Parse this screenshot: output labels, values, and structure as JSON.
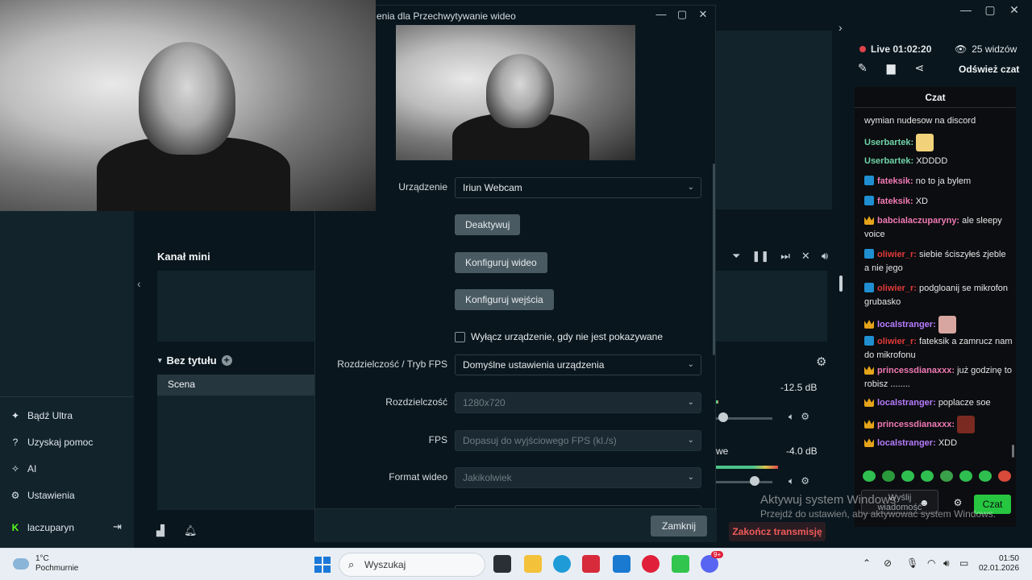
{
  "app": {
    "window_controls": [
      "—",
      "▢",
      "✕"
    ],
    "left_sidebar": {
      "items": [
        {
          "icon": "sparkle-icon",
          "label": "Bądź Ultra"
        },
        {
          "icon": "help-icon",
          "label": "Uzyskaj pomoc"
        },
        {
          "icon": "ai-icon",
          "label": "AI"
        },
        {
          "icon": "gear-icon",
          "label": "Ustawienia"
        }
      ],
      "user": {
        "icon": "kick-logo-icon",
        "name": "laczuparyn",
        "logout_icon": "logout-icon"
      }
    },
    "channel": {
      "title": "Kanał mini"
    },
    "scenes": {
      "title": "Bez tytułu",
      "items": [
        "Scena"
      ]
    },
    "mixer": {
      "tracks": [
        {
          "label": "",
          "db": "-12.5 dB",
          "level": 0.03
        },
        {
          "label": "we",
          "db": "-4.0 dB",
          "level": 0.7
        }
      ]
    },
    "end_stream_label": "Zakończ transmisję"
  },
  "stream_panel": {
    "live_label": "Live 01:02:20",
    "viewers_label": "25 widzów",
    "refresh_chat_label": "Odśwież czat",
    "chat_title": "Czat",
    "messages": [
      {
        "badge": "",
        "user": "",
        "user_color": "#ffffff",
        "text": "wymian nudesow na discord",
        "emote": false
      },
      {
        "badge": "",
        "user": "Userbartek:",
        "user_color": "#6fd3a8",
        "text": "",
        "emote": true
      },
      {
        "badge": "",
        "user": "Userbartek:",
        "user_color": "#6fd3a8",
        "text": "XDDDD",
        "emote": false
      },
      {
        "badge": "blue",
        "user": "fateksik:",
        "user_color": "#f07ab4",
        "text": "no to ja bylem",
        "emote": false
      },
      {
        "badge": "blue",
        "user": "fateksik:",
        "user_color": "#f07ab4",
        "text": "XD",
        "emote": false
      },
      {
        "badge": "crown",
        "user": "babcialaczuparyny:",
        "user_color": "#f07ab4",
        "text": "ale sleepy voice",
        "emote": false
      },
      {
        "badge": "blue",
        "user": "oliwier_r:",
        "user_color": "#e03a3a",
        "text": "siebie ściszyłeś zjeble a nie jego",
        "emote": false
      },
      {
        "badge": "blue",
        "user": "oliwier_r:",
        "user_color": "#e03a3a",
        "text": "podgloanij se mikrofon grubasko",
        "emote": false
      },
      {
        "badge": "crown",
        "user": "localstranger:",
        "user_color": "#b77cff",
        "text": "",
        "emote": true
      },
      {
        "badge": "blue",
        "user": "oliwier_r:",
        "user_color": "#e03a3a",
        "text": "fateksik a zamrucz nam do mikrofonu",
        "emote": false
      },
      {
        "badge": "crown",
        "user": "princessdianaxxx:",
        "user_color": "#f07ab4",
        "text": "już godzinę to robisz ........",
        "emote": false
      },
      {
        "badge": "crown",
        "user": "localstranger:",
        "user_color": "#b77cff",
        "text": "poplacze soe",
        "emote": false
      },
      {
        "badge": "crown",
        "user": "princessdianaxxx:",
        "user_color": "#f07ab4",
        "text": "",
        "emote": true
      },
      {
        "badge": "crown",
        "user": "localstranger:",
        "user_color": "#b77cff",
        "text": "XDD",
        "emote": false
      }
    ],
    "input_placeholder": "Wyślij wiadomość",
    "send_label": "Czat"
  },
  "dialog": {
    "title": "enia dla Przechwytywanie wideo",
    "controls": [
      "—",
      "▢",
      "✕"
    ],
    "device_label": "Urządzenie",
    "device_value": "Iriun Webcam",
    "deactivate_label": "Deaktywuj",
    "configure_video_label": "Konfiguruj wideo",
    "configure_input_label": "Konfiguruj wejścia",
    "checkbox_label": "Wyłącz urządzenie, gdy nie jest pokazywane",
    "res_fps_label": "Rozdzielczość / Tryb FPS",
    "res_fps_value": "Domyślne ustawienia urządzenia",
    "resolution_label": "Rozdzielczość",
    "resolution_value": "1280x720",
    "fps_label": "FPS",
    "fps_value": "Dopasuj do wyjściowego FPS (kl./s)",
    "format_label": "Format wideo",
    "format_value": "Jakikolwiek",
    "close_label": "Zamknij"
  },
  "windows_activation": {
    "line1": "Aktywuj system Windows",
    "line2": "Przejdź do ustawień, aby aktywować system Windows."
  },
  "taskbar": {
    "weather_temp": "1°C",
    "weather_desc": "Pochmurnie",
    "search_placeholder": "Wyszukaj",
    "time": "01:50",
    "date": "02.01.2026",
    "discord_badge": "9+"
  }
}
